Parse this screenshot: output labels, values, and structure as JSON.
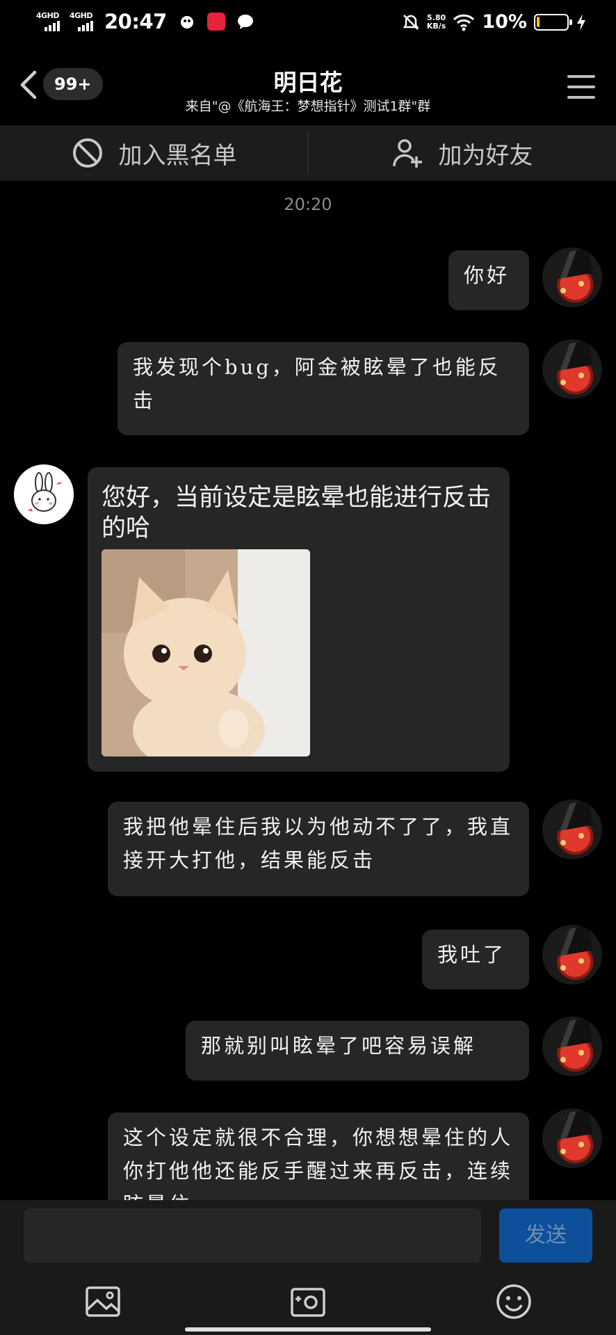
{
  "status_bar": {
    "net1": "4GHD",
    "net2": "4GHD",
    "time": "20:47",
    "speed_value": "5.80",
    "speed_unit": "KB/s",
    "battery_percent": "10%",
    "battery_level": 0.1
  },
  "header": {
    "unread_badge": "99+",
    "title": "明日花",
    "subtitle": "来自\"@《航海王：梦想指针》测试1群\"群"
  },
  "actions": {
    "blacklist_label": "加入黑名单",
    "add_friend_label": "加为好友"
  },
  "chat": {
    "timestamp": "20:20",
    "messages": [
      {
        "side": "right",
        "text": "你好"
      },
      {
        "side": "right",
        "text": "我发现个bug，阿金被眩晕了也能反击"
      },
      {
        "side": "left",
        "text": "您好，当前设定是眩晕也能进行反击的哈"
      },
      {
        "side": "right",
        "text": "我把他晕住后我以为他动不了了，我直接开大打他，结果能反击"
      },
      {
        "side": "right",
        "text": "我吐了"
      },
      {
        "side": "right",
        "text": "那就别叫眩晕了吧容易误解"
      },
      {
        "side": "right",
        "text": "这个设定就很不合理，你想想晕住的人你打他他还能反手醒过来再反击，连续眩晕住"
      }
    ]
  },
  "input": {
    "placeholder": "",
    "send_label": "发送"
  },
  "icons": {
    "image": "image-icon",
    "camera": "camera-icon",
    "emoji": "emoji-icon"
  },
  "colors": {
    "background": "#000000",
    "bubble": "#262626",
    "send_button": "#0d4f99",
    "battery_low": "#f5c400"
  }
}
